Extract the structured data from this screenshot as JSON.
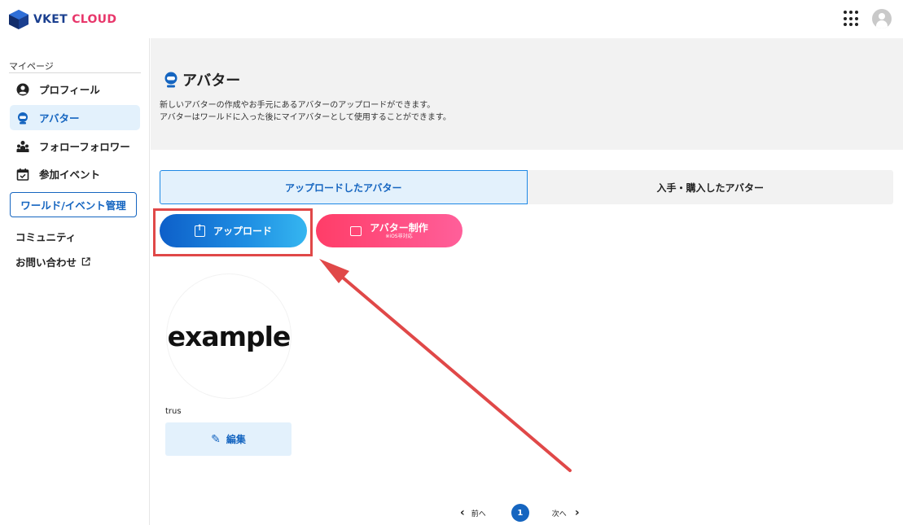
{
  "header": {
    "logo_part1": "VKET",
    "logo_part2": "CLOUD",
    "apps_icon": "grid-apps-icon",
    "account_icon": "user-avatar-icon"
  },
  "sidebar": {
    "heading": "マイページ",
    "items": [
      {
        "label": "プロフィール",
        "icon": "profile-icon"
      },
      {
        "label": "アバター",
        "icon": "avatar-icon",
        "active": true
      },
      {
        "label": "フォローフォロワー",
        "icon": "people-icon"
      },
      {
        "label": "参加イベント",
        "icon": "calendar-check-icon"
      }
    ],
    "manage_button": "ワールド/イベント管理",
    "community": "コミュニティ",
    "contact": "お問い合わせ",
    "contact_icon": "external-link-icon"
  },
  "page": {
    "title": "アバター",
    "description_line1": "新しいアバターの作成やお手元にあるアバターのアップロードができます。",
    "description_line2": "アバターはワールドに入った後にマイアバターとして使用することができます。"
  },
  "tabs": [
    {
      "label": "アップロードしたアバター",
      "active": true
    },
    {
      "label": "入手・購入したアバター",
      "active": false
    }
  ],
  "actions": {
    "upload_label": "アップロード",
    "create_label": "アバター制作",
    "create_sublabel": "※iOS非対応"
  },
  "avatar_card": {
    "image_text": "example",
    "name": "trus",
    "edit_label": "編集"
  },
  "pagination": {
    "prev_label": "前へ",
    "current_page": "1",
    "next_label": "次へ"
  },
  "colors": {
    "primary": "#1565c0",
    "accent_pink": "#ff3d68",
    "annotation_red": "#e04848"
  }
}
